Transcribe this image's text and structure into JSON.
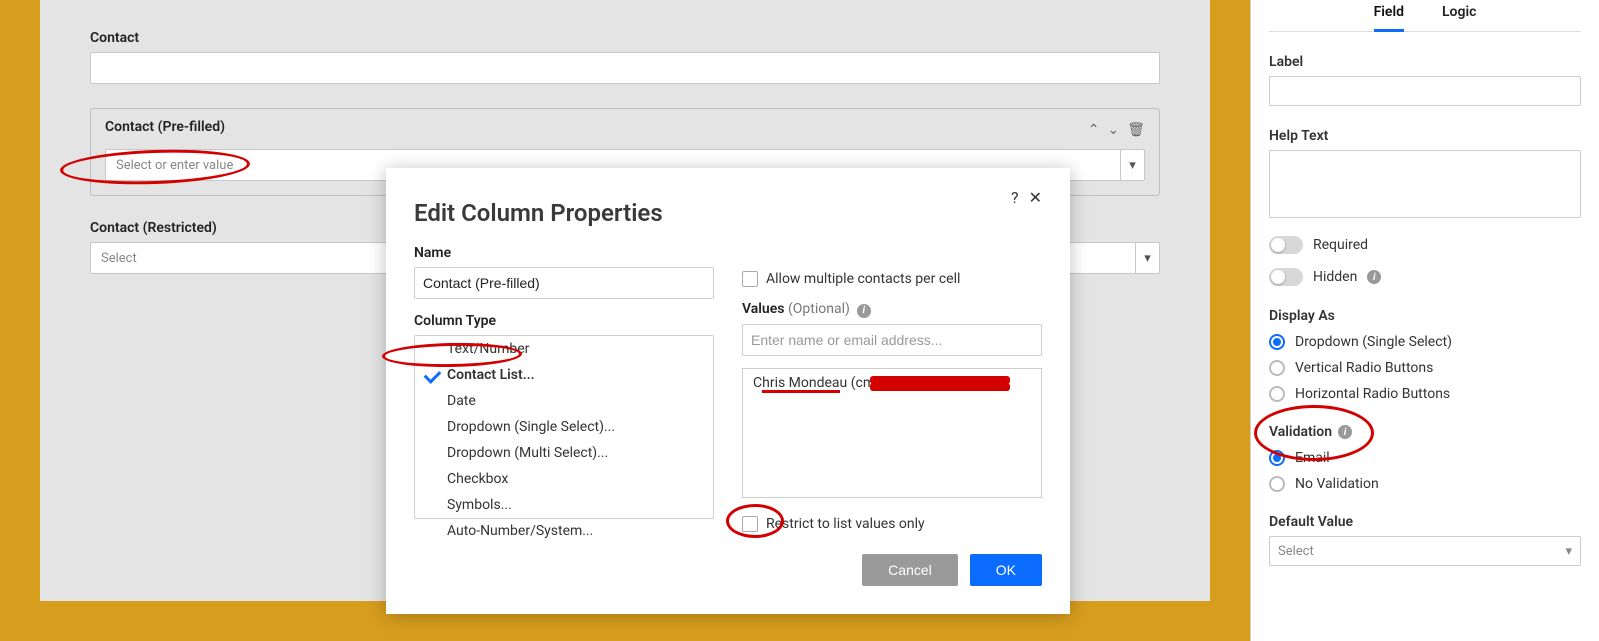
{
  "form": {
    "field_contact": {
      "label": "Contact"
    },
    "field_contact_prefilled": {
      "label": "Contact (Pre-filled)",
      "placeholder": "Select or enter value"
    },
    "field_contact_restricted": {
      "label": "Contact (Restricted)",
      "placeholder": "Select"
    }
  },
  "modal": {
    "title": "Edit Column Properties",
    "name_label": "Name",
    "name_value": "Contact (Pre-filled)",
    "column_type_label": "Column Type",
    "types": [
      "Text/Number",
      "Contact List...",
      "Date",
      "Dropdown (Single Select)...",
      "Dropdown (Multi Select)...",
      "Checkbox",
      "Symbols...",
      "Auto-Number/System..."
    ],
    "selected_type_index": 1,
    "allow_multiple_label": "Allow multiple contacts per cell",
    "values_label": "Values",
    "values_optional": "(Optional)",
    "values_placeholder": "Enter name or email address...",
    "values_items": [
      "Chris Mondeau (cm"
    ],
    "restrict_label": "Restrict to list values only",
    "cancel": "Cancel",
    "ok": "OK"
  },
  "sidebar": {
    "tabs": {
      "field": "Field",
      "logic": "Logic"
    },
    "active_tab": "field",
    "label_label": "Label",
    "helptext_label": "Help Text",
    "required_label": "Required",
    "hidden_label": "Hidden",
    "display_as_label": "Display As",
    "display_as_options": [
      "Dropdown (Single Select)",
      "Vertical Radio Buttons",
      "Horizontal Radio Buttons"
    ],
    "display_as_selected_index": 0,
    "validation_label": "Validation",
    "validation_options": [
      "Email",
      "No Validation"
    ],
    "validation_selected_index": 0,
    "default_value_label": "Default Value",
    "default_value_placeholder": "Select"
  }
}
